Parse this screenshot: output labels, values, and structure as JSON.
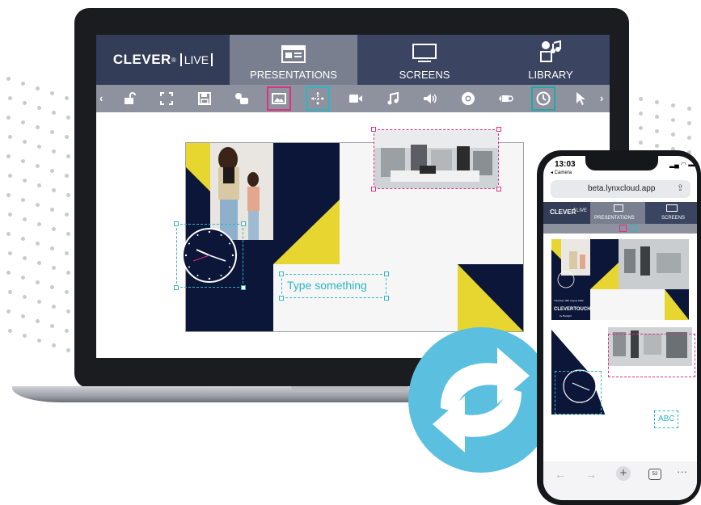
{
  "laptop": {
    "brand": {
      "name": "CLEVER",
      "reg": "®",
      "live": "LIVE"
    },
    "nav_tabs": [
      {
        "label": "PRESENTATIONS",
        "active": true,
        "icon": "presentation-icon"
      },
      {
        "label": "SCREENS",
        "active": false,
        "icon": "monitor-icon"
      },
      {
        "label": "LIBRARY",
        "active": false,
        "icon": "media-library-icon"
      }
    ],
    "toolbar": [
      {
        "icon": "chevron-left-icon"
      },
      {
        "icon": "unlock-icon"
      },
      {
        "icon": "fullscreen-icon"
      },
      {
        "icon": "save-icon"
      },
      {
        "icon": "shapes-icon"
      },
      {
        "icon": "image-icon",
        "selected": "pink"
      },
      {
        "icon": "move-icon",
        "selected": "teal"
      },
      {
        "icon": "video-icon"
      },
      {
        "icon": "music-icon"
      },
      {
        "icon": "volume-icon"
      },
      {
        "icon": "browser-icon"
      },
      {
        "icon": "stream-icon"
      },
      {
        "icon": "clock-icon",
        "selected": "teal"
      },
      {
        "icon": "pointer-icon"
      },
      {
        "icon": "chevron-right-icon"
      }
    ],
    "slide": {
      "text_box": "Type something"
    },
    "colors": {
      "navy": "#0b1638",
      "yellow": "#e6d62f",
      "pink": "#e0307f",
      "teal": "#2db6c3"
    }
  },
  "phone": {
    "status_time": "13:03",
    "back_label": "◂ Camera",
    "url": "beta.lynxcloud.app",
    "brand": {
      "name": "CLEVER",
      "reg": "®",
      "live": "LIVE"
    },
    "nav_tabs": [
      {
        "label": "PRESENTATIONS",
        "active": true
      },
      {
        "label": "SCREENS",
        "active": false
      }
    ],
    "slide_caption": "Thursday 18th August 2022",
    "slide_brand": "CLEVERTOUCH",
    "slide_brand_sub": "by Boxlight",
    "text_box": "ABC",
    "tab_count": "52"
  }
}
